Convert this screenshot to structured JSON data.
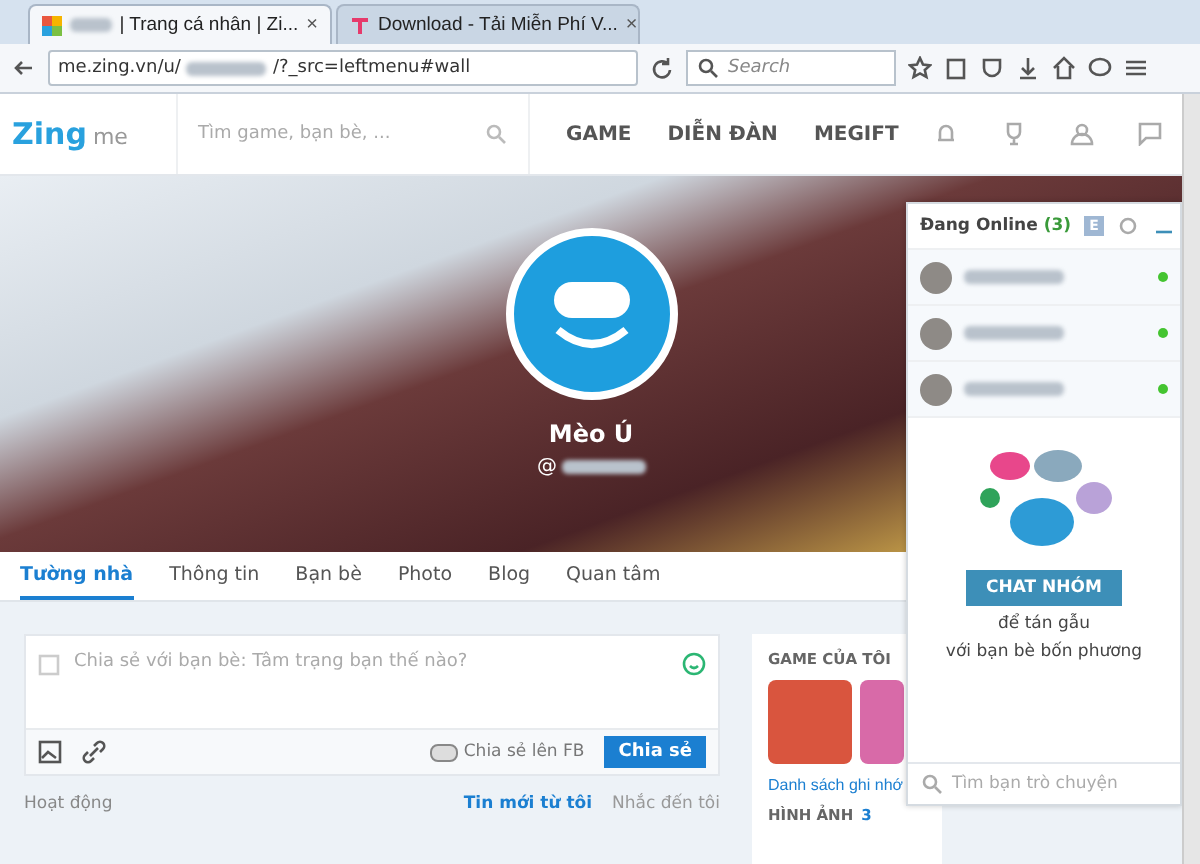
{
  "browser": {
    "tabs": [
      {
        "title": "| Trang cá nhân | Zi...",
        "selected": true,
        "kind": "zing",
        "close": "×"
      },
      {
        "title": "Download - Tải Miễn Phí V...",
        "selected": false,
        "kind": "download",
        "close": "×"
      }
    ],
    "url_prefix": "me.zing.vn/u/",
    "url_suffix": "/?_src=leftmenu#wall",
    "search_placeholder": "Search"
  },
  "header": {
    "logo": "Zing",
    "logo_sub": "me",
    "search_placeholder": "Tìm game, bạn bè, ...",
    "nav": [
      "GAME",
      "DIỄN ĐÀN",
      "MEGIFT"
    ]
  },
  "profile": {
    "name": "Mèo Ú",
    "handle": "@"
  },
  "profile_tabs": [
    {
      "label": "Tường nhà",
      "selected": true
    },
    {
      "label": "Thông tin",
      "selected": false
    },
    {
      "label": "Bạn bè",
      "selected": false
    },
    {
      "label": "Photo",
      "selected": false
    },
    {
      "label": "Blog",
      "selected": false
    },
    {
      "label": "Quan tâm",
      "selected": false
    }
  ],
  "composer": {
    "placeholder": "Chia sẻ với bạn bè: Tâm trạng bạn thế nào?",
    "share_fb": "Chia sẻ lên FB",
    "share_fb_on": false,
    "submit": "Chia sẻ"
  },
  "feed": {
    "title": "Hoạt động",
    "filters": [
      {
        "label": "Tin mới từ tôi",
        "selected": true
      },
      {
        "label": "Nhắc đến tôi",
        "selected": false
      }
    ]
  },
  "sidebar": {
    "games_title": "GAME CỦA TÔI",
    "bookmark": "Danh sách ghi nhớ",
    "photos_title": "HÌNH ẢNH",
    "photos_count": "3"
  },
  "chat": {
    "title": "Đang Online",
    "count": "(3)",
    "e_badge": "E",
    "contacts": [
      {
        "online": true
      },
      {
        "online": true
      },
      {
        "online": true
      }
    ],
    "group_button": "CHAT NHÓM",
    "group_text": "để tán gẫu",
    "group_text2": "với bạn bè bốn phương",
    "search_placeholder": "Tìm bạn trò chuyện"
  }
}
